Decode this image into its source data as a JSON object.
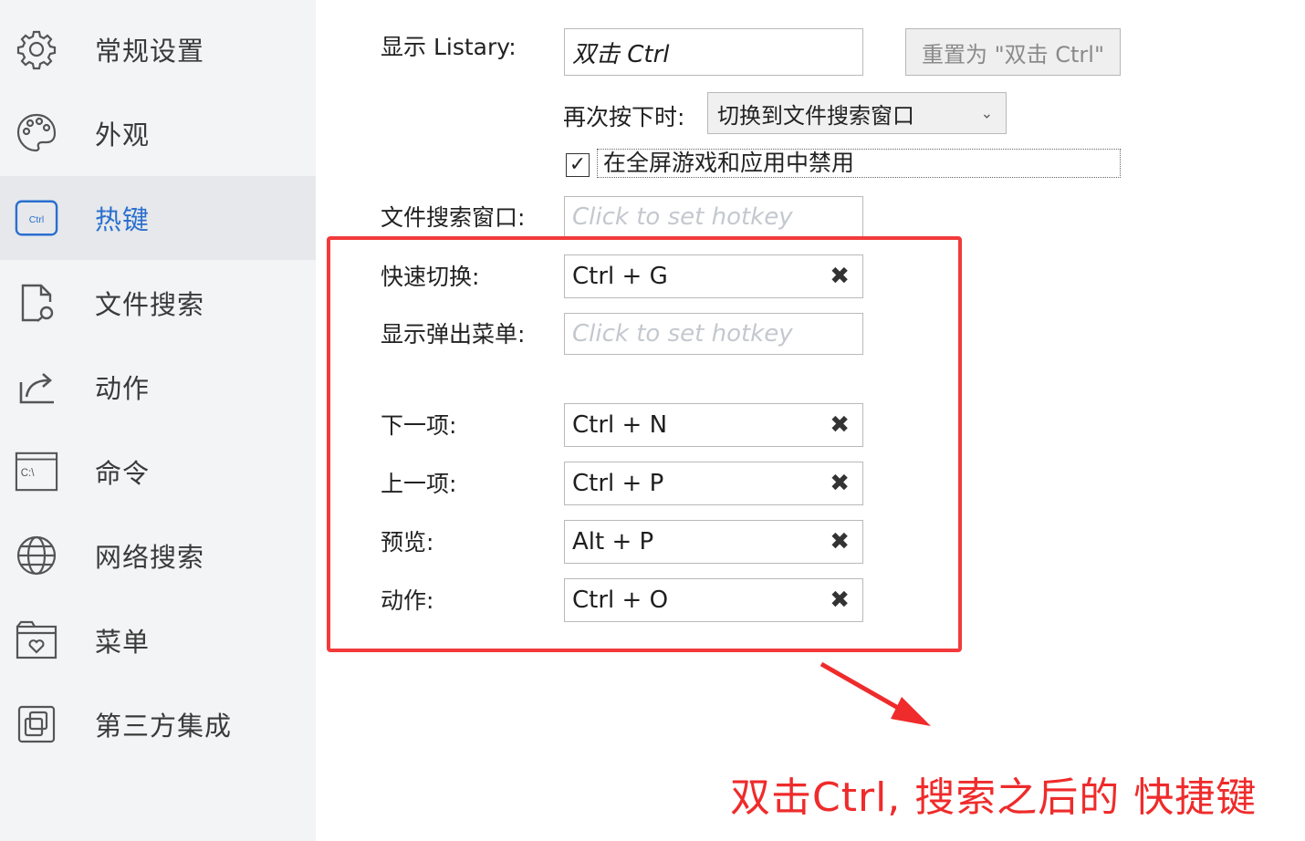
{
  "sidebar": {
    "items": [
      {
        "label": "常规设置",
        "icon": "gear-icon"
      },
      {
        "label": "外观",
        "icon": "palette-icon"
      },
      {
        "label": "热键",
        "icon": "ctrl-key-icon",
        "icon_text": "Ctrl",
        "active": true
      },
      {
        "label": "文件搜索",
        "icon": "file-search-icon"
      },
      {
        "label": "动作",
        "icon": "share-action-icon"
      },
      {
        "label": "命令",
        "icon": "command-prompt-icon",
        "icon_text": "C:\\"
      },
      {
        "label": "网络搜索",
        "icon": "globe-icon"
      },
      {
        "label": "菜单",
        "icon": "menu-folder-icon"
      },
      {
        "label": "第三方集成",
        "icon": "integration-icon"
      }
    ]
  },
  "hotkeys": {
    "show_listary": {
      "label": "显示 Listary:",
      "value": "双击 Ctrl"
    },
    "reset_button": "重置为 \"双击 Ctrl\"",
    "press_again": {
      "label": "再次按下时:",
      "selected": "切换到文件搜索窗口"
    },
    "disable_fullscreen": {
      "label": "在全屏游戏和应用中禁用",
      "checked": true,
      "check_mark": "✓"
    },
    "file_search_window": {
      "label": "文件搜索窗口:",
      "placeholder": "Click to set hotkey"
    },
    "quick_switch": {
      "label": "快速切换:",
      "value": "Ctrl + G"
    },
    "show_popup_menu": {
      "label": "显示弹出菜单:",
      "placeholder": "Click to set hotkey"
    },
    "next_item": {
      "label": "下一项:",
      "value": "Ctrl + N"
    },
    "prev_item": {
      "label": "上一项:",
      "value": "Ctrl + P"
    },
    "preview": {
      "label": "预览:",
      "value": "Alt + P"
    },
    "action": {
      "label": "动作:",
      "value": "Ctrl + O"
    },
    "clear_symbol": "✖"
  },
  "annotation": {
    "text": "双击Ctrl, 搜索之后的  快捷键",
    "color": "#ef2b2b"
  },
  "colors": {
    "accent": "#2a6fcf",
    "highlight_border": "#f23a3a",
    "placeholder": "#c4c8ce"
  }
}
